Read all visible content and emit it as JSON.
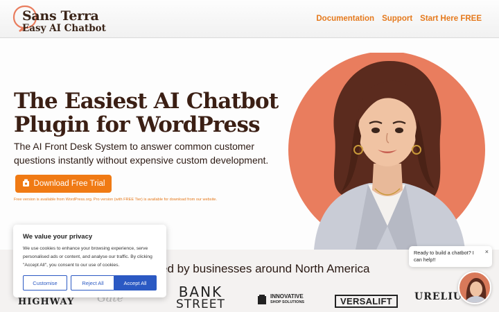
{
  "header": {
    "logo_line1": "Sans Terra",
    "logo_line2": "Easy AI Chatbot",
    "nav": [
      "Documentation",
      "Support",
      "Start Here FREE"
    ]
  },
  "hero": {
    "title_line1": "The Easiest AI Chatbot",
    "title_line2": "Plugin for WordPress",
    "subtitle": "The AI Front Desk System to answer common customer questions instantly without expensive custom development.",
    "cta_label": "Download Free Trial",
    "note": "Free version is available from WordPress.org. Pro version (with FREE Tier) is available for download from our website."
  },
  "trusted": {
    "heading": "ed by businesses around North America",
    "logos": [
      "HIGHWAY",
      "Gate",
      "BANK",
      "STREET",
      "INNOVATIVE",
      "SHOP SOLUTIONS",
      "VERSALIFT",
      "URELIUS"
    ]
  },
  "cookie": {
    "title": "We value your privacy",
    "text": "We use cookies to enhance your browsing experience, serve personalised ads or content, and analyse our traffic. By clicking \"Accept All\", you consent to our use of cookies.",
    "customise": "Customise",
    "reject": "Reject All",
    "accept": "Accept All"
  },
  "chat": {
    "message": "Ready to build a chatbot? I can help!!",
    "close": "×"
  },
  "colors": {
    "accent": "#f07a14",
    "link": "#e5791c",
    "title": "#3b1f14",
    "cookie_blue": "#2b59c3",
    "portrait_circle": "#e97d5e"
  },
  "icons": [
    "chat-bubble-logo-icon",
    "download-icon",
    "close-icon",
    "chat-avatar-icon"
  ]
}
